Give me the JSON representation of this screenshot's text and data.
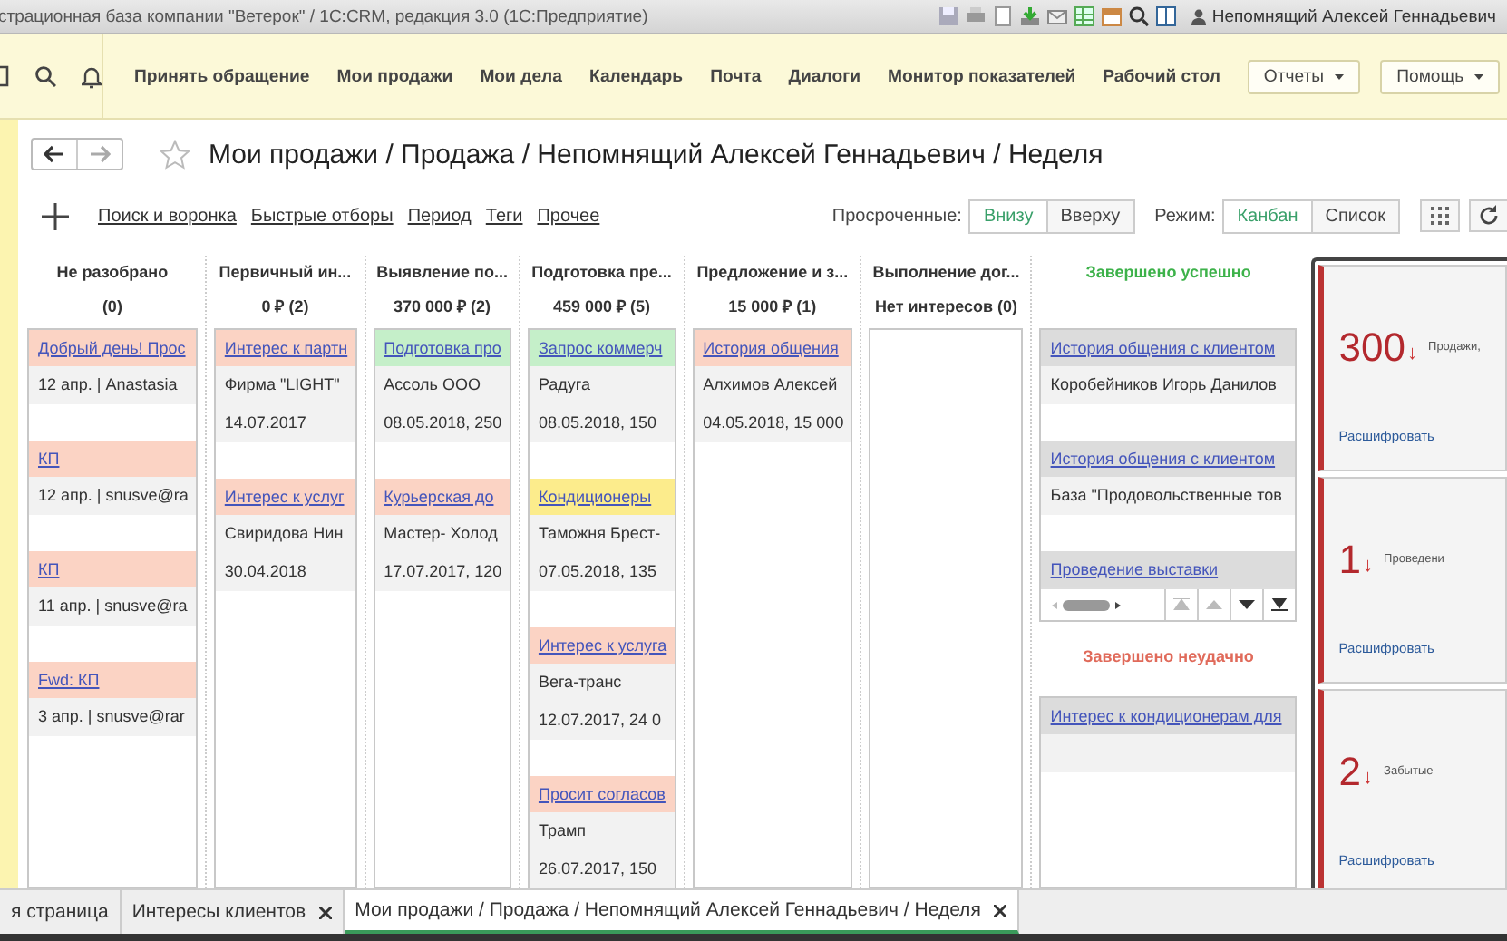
{
  "title_bar": {
    "title": "страционная база компании \"Ветерок\" / 1С:CRM, редакция 3.0  (1С:Предприятие)",
    "user": "Непомнящий Алексей Геннадьевич"
  },
  "nav": {
    "items": [
      "Принять обращение",
      "Мои продажи",
      "Мои дела",
      "Календарь",
      "Почта",
      "Диалоги",
      "Монитор показателей",
      "Рабочий стол"
    ],
    "menus": [
      "Отчеты",
      "Помощь"
    ]
  },
  "page": {
    "title": "Мои продажи / Продажа / Непомнящий Алексей Геннадьевич / Неделя"
  },
  "toolbar": {
    "links": [
      "Поиск и воронка",
      "Быстрые отборы",
      "Период",
      "Теги",
      "Прочее"
    ],
    "overdue": {
      "label": "Просроченные:",
      "options": [
        {
          "label": "Внизу",
          "selected": true
        },
        {
          "label": "Вверху",
          "selected": false
        }
      ]
    },
    "mode": {
      "label": "Режим:",
      "options": [
        {
          "label": "Канбан",
          "selected": true
        },
        {
          "label": "Список",
          "selected": false
        }
      ]
    }
  },
  "columns": [
    {
      "title": "Не разобрано",
      "total": "(0)",
      "cards": [
        {
          "title": "Добрый день! Прос",
          "color": "#fbd3c4",
          "lines": [
            "12 апр. | Anastasia"
          ]
        },
        {
          "title": "КП",
          "color": "#fbd3c4",
          "lines": [
            "12 апр. | snusve@ra"
          ]
        },
        {
          "title": "КП",
          "color": "#fbd3c4",
          "lines": [
            "11 апр. | snusve@ra"
          ]
        },
        {
          "title": "Fwd: КП",
          "color": "#fbd3c4",
          "lines": [
            "3 апр. | snusve@rar"
          ]
        }
      ]
    },
    {
      "title": "Первичный ин...",
      "total": "0 ₽ (2)",
      "cards": [
        {
          "title": "Интерес к партн",
          "color": "#fbd3c4",
          "lines": [
            "Фирма \"LIGHT\"",
            "14.07.2017"
          ]
        },
        {
          "title": "Интерес к услуг",
          "color": "#fbd3c4",
          "lines": [
            "Свиридова Нин",
            "30.04.2018"
          ]
        }
      ]
    },
    {
      "title": "Выявление по...",
      "total": "370 000 ₽ (2)",
      "cards": [
        {
          "title": "Подготовка про",
          "color": "#c5efc9",
          "lines": [
            "Ассоль ООО",
            "08.05.2018, 250"
          ]
        },
        {
          "title": "Курьерская до",
          "color": "#fbd3c4",
          "lines": [
            "Мастер- Холод",
            "17.07.2017, 120"
          ]
        }
      ]
    },
    {
      "title": "Подготовка пре...",
      "total": "459 000 ₽ (5)",
      "cards": [
        {
          "title": "Запрос коммерч",
          "color": "#c5efc9",
          "lines": [
            "Радуга",
            "08.05.2018, 150"
          ]
        },
        {
          "title": "Кондиционеры",
          "color": "#fcec8c",
          "lines": [
            "Таможня Брест-",
            "07.05.2018, 135"
          ]
        },
        {
          "title": "Интерес к услуга",
          "color": "#fbd3c4",
          "lines": [
            "Вега-транс",
            "12.07.2017, 24 0"
          ]
        },
        {
          "title": "Просит согласов",
          "color": "#fbd3c4",
          "lines": [
            "Трамп",
            "26.07.2017, 150"
          ]
        }
      ]
    },
    {
      "title": "Предложение и з...",
      "total": "15 000 ₽ (1)",
      "cards": [
        {
          "title": "История общения",
          "color": "#fbd3c4",
          "lines": [
            "Алхимов Алексей",
            "04.05.2018, 15 000"
          ]
        }
      ]
    },
    {
      "title": "Выполнение дог...",
      "total": "Нет интересов (0)"
    }
  ],
  "completed": [
    {
      "kind": "success",
      "title": "Завершено успешно",
      "cards": [
        {
          "title": "История общения с клиентом",
          "lines": [
            "Коробейников Игорь Данилов"
          ]
        },
        {
          "title": "История общения с клиентом",
          "lines": [
            "База \"Продовольственные тов"
          ]
        },
        {
          "title": "Проведение выставки"
        }
      ]
    },
    {
      "kind": "failure",
      "title": "Завершено неудачно",
      "cards": [
        {
          "title": "Интерес к кондиционерам для"
        }
      ]
    }
  ],
  "widgets": [
    {
      "value": "300",
      "arrow": "↓",
      "label": "Продажи,",
      "link": "Расшифровать"
    },
    {
      "value": "1",
      "arrow": "↓",
      "label": "Проведени",
      "link": "Расшифровать"
    },
    {
      "value": "2",
      "arrow": "↓",
      "label": "Забытые",
      "link": "Расшифровать"
    }
  ],
  "tabs": [
    {
      "label": "я страница",
      "selected": false,
      "closable": false
    },
    {
      "label": "Интересы клиентов",
      "selected": false,
      "closable": true
    },
    {
      "label": "Мои продажи / Продажа / Непомнящий Алексей Геннадьевич / Неделя",
      "selected": true,
      "closable": true
    }
  ]
}
